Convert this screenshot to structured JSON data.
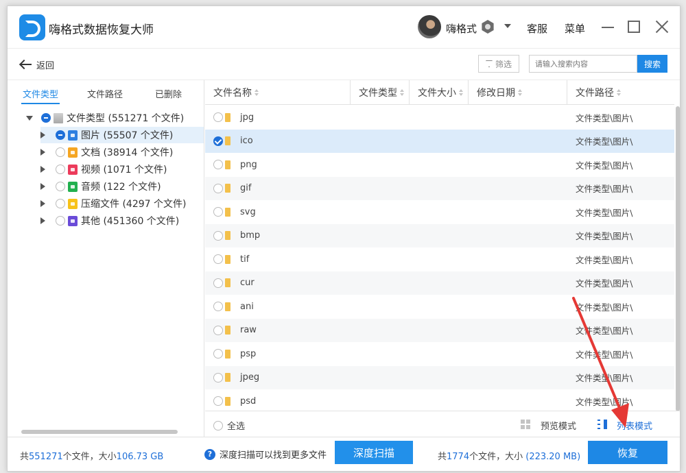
{
  "app": {
    "title": "嗨格式数据恢复大师",
    "user_name": "嗨格式",
    "support_label": "客服",
    "menu_label": "菜单"
  },
  "toolbar": {
    "back_label": "返回",
    "filter_label": "筛选",
    "search_placeholder": "请输入搜索内容",
    "search_label": "搜索"
  },
  "left_tabs": [
    "文件类型",
    "文件路径",
    "已删除"
  ],
  "tree": {
    "root": "文件类型 (551271 个文件)",
    "children": [
      {
        "label": "图片 (55507 个文件)",
        "icon": "image-file-icon"
      },
      {
        "label": "文档 (38914 个文件)",
        "icon": "document-file-icon"
      },
      {
        "label": "视频 (1071 个文件)",
        "icon": "video-file-icon"
      },
      {
        "label": "音频 (122 个文件)",
        "icon": "audio-file-icon"
      },
      {
        "label": "压缩文件 (4297 个文件)",
        "icon": "archive-file-icon"
      },
      {
        "label": "其他 (451360 个文件)",
        "icon": "other-file-icon"
      }
    ]
  },
  "table": {
    "columns": [
      "文件名称",
      "文件类型",
      "文件大小",
      "修改日期",
      "文件路径"
    ],
    "rows": [
      {
        "name": "jpg",
        "path": "文件类型\\图片\\"
      },
      {
        "name": "ico",
        "path": "文件类型\\图片\\",
        "checked": true
      },
      {
        "name": "png",
        "path": "文件类型\\图片\\"
      },
      {
        "name": "gif",
        "path": "文件类型\\图片\\"
      },
      {
        "name": "svg",
        "path": "文件类型\\图片\\"
      },
      {
        "name": "bmp",
        "path": "文件类型\\图片\\"
      },
      {
        "name": "tif",
        "path": "文件类型\\图片\\"
      },
      {
        "name": "cur",
        "path": "文件类型\\图片\\"
      },
      {
        "name": "ani",
        "path": "文件类型\\图片\\"
      },
      {
        "name": "raw",
        "path": "文件类型\\图片\\"
      },
      {
        "name": "psp",
        "path": "文件类型\\图片\\"
      },
      {
        "name": "jpeg",
        "path": "文件类型\\图片\\"
      },
      {
        "name": "psd",
        "path": "文件类型\\图片\\"
      }
    ],
    "select_all_label": "全选",
    "preview_mode_label": "预览模式",
    "list_mode_label": "列表模式"
  },
  "status": {
    "total_prefix": "共",
    "total_count": "551271",
    "total_mid": "个文件，大小",
    "total_size": "106.73 GB",
    "hint": "深度扫描可以找到更多文件",
    "deep_scan_label": "深度扫描",
    "selected_prefix": "共",
    "selected_count": "1774",
    "selected_mid": "个文件，大小 ",
    "selected_size": "(223.20 MB)",
    "recover_label": "恢复"
  },
  "colors": {
    "accent": "#1e88e5",
    "annotation_arrow": "#e53935"
  }
}
